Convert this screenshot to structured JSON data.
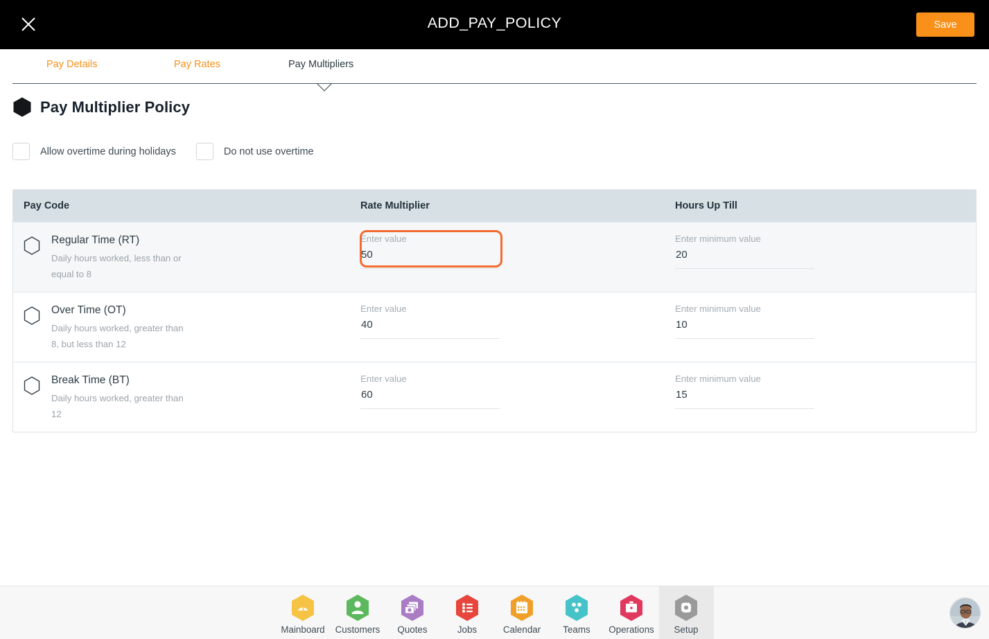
{
  "topbar": {
    "close_icon": "close-icon",
    "title": "ADD_PAY_POLICY",
    "save_label": "Save",
    "save_color": "#f99019",
    "background": "#000000"
  },
  "tabs": {
    "items": [
      {
        "label": "Pay Details",
        "active": false
      },
      {
        "label": "Pay Rates",
        "active": false
      },
      {
        "label": "Pay Multipliers",
        "active": true
      }
    ],
    "inactive_color": "#f99019",
    "active_color": "#2b3a42"
  },
  "section": {
    "icon": "hexagon-icon",
    "title": "Pay Multiplier Policy"
  },
  "options": {
    "checkboxes": [
      {
        "label": "Allow overtime during holidays",
        "checked": false
      },
      {
        "label": "Do not use overtime",
        "checked": false
      }
    ]
  },
  "table": {
    "headers": {
      "pay_code": "Pay Code",
      "rate_multiplier": "Rate Multiplier",
      "hours_up_till": "Hours Up Till"
    },
    "rows": [
      {
        "icon": "hexagon-outline-icon",
        "name": "Regular Time (RT)",
        "description": "Daily hours worked, less than or equal to 8",
        "rate": {
          "label": "Enter value",
          "placeholder": "Enter value",
          "value": "50"
        },
        "hours": {
          "label": "Enter minimum value",
          "placeholder": "Enter minimum value",
          "value": "20"
        },
        "shaded": true,
        "highlighted": true
      },
      {
        "icon": "hexagon-outline-icon",
        "name": "Over Time (OT)",
        "description": "Daily hours worked, greater than 8, but less than 12",
        "rate": {
          "label": "Enter value",
          "placeholder": "Enter value",
          "value": "40"
        },
        "hours": {
          "label": "Enter minimum value",
          "placeholder": "Enter minimum value",
          "value": "10"
        },
        "shaded": false,
        "highlighted": false
      },
      {
        "icon": "hexagon-outline-icon",
        "name": "Break Time (BT)",
        "description": "Daily hours worked, greater than 12",
        "rate": {
          "label": "Enter value",
          "placeholder": "Enter value",
          "value": "60"
        },
        "hours": {
          "label": "Enter minimum value",
          "placeholder": "Enter minimum value",
          "value": "15"
        },
        "shaded": false,
        "highlighted": false
      }
    ]
  },
  "highlight": {
    "target": "rate-multiplier-input-row-1",
    "color": "#f26b33"
  },
  "bottom_nav": {
    "items": [
      {
        "label": "Mainboard",
        "icon": "mainboard-hex-icon",
        "color": "#f6c344",
        "active": false
      },
      {
        "label": "Customers",
        "icon": "customers-hex-icon",
        "color": "#5cb85c",
        "active": false
      },
      {
        "label": "Quotes",
        "icon": "quotes-hex-icon",
        "color": "#a97cc4",
        "active": false
      },
      {
        "label": "Jobs",
        "icon": "jobs-hex-icon",
        "color": "#e8453c",
        "active": false
      },
      {
        "label": "Calendar",
        "icon": "calendar-hex-icon",
        "color": "#f0a028",
        "active": false
      },
      {
        "label": "Teams",
        "icon": "teams-hex-icon",
        "color": "#45c3c8",
        "active": false
      },
      {
        "label": "Operations",
        "icon": "operations-hex-icon",
        "color": "#e0385f",
        "active": false
      },
      {
        "label": "Setup",
        "icon": "setup-hex-icon",
        "color": "#9a9a9a",
        "active": true
      }
    ],
    "avatar": "user-avatar"
  }
}
